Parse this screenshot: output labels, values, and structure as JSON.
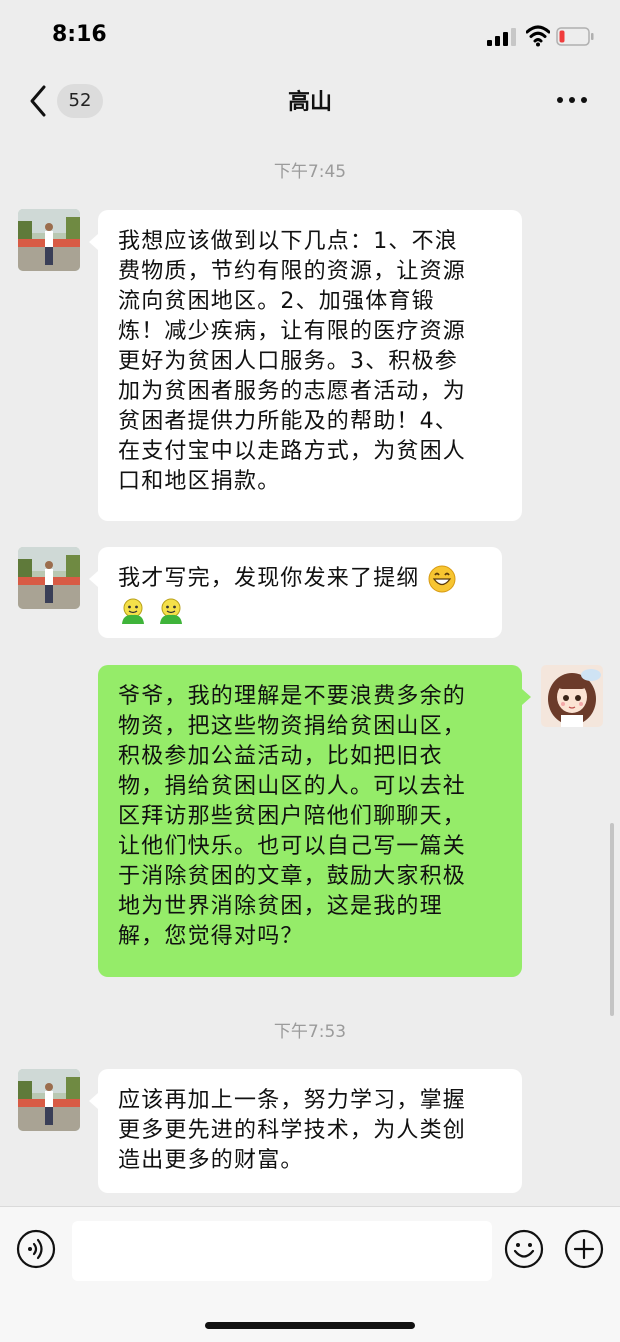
{
  "status_bar": {
    "time": "8:16"
  },
  "nav": {
    "unread_count": "52",
    "title": "高山"
  },
  "messages": [
    {
      "timestamp": "下午7:45"
    },
    {
      "sender": "other",
      "text": [
        "我想应该做到以下几点：1、不浪",
        "费物质，节约有限的资源，让资源",
        "流向贫困地区。2、加强体育锻",
        "炼！减少疾病，让有限的医疗资源",
        "更好为贫困人口服务。3、积极参",
        "加为贫困者服务的志愿者活动，为",
        "贫困者提供力所能及的帮助！4、",
        "在支付宝中以走路方式，为贫困人",
        "口和地区捐款。"
      ]
    },
    {
      "sender": "other",
      "text": [
        "我才写完，发现你发来了提纲"
      ],
      "emojis": [
        "grinning-emoji",
        "wechat-pig-emoji",
        "wechat-pig-emoji"
      ]
    },
    {
      "sender": "me",
      "text": [
        "爷爷，我的理解是不要浪费多余的",
        "物资，把这些物资捐给贫困山区，",
        "积极参加公益活动，比如把旧衣",
        "物，捐给贫困山区的人。可以去社",
        "区拜访那些贫困户陪他们聊聊天，",
        "让他们快乐。也可以自己写一篇关",
        "于消除贫困的文章，鼓励大家积极",
        "地为世界消除贫困，这是我的理",
        "解，您觉得对吗？"
      ]
    },
    {
      "timestamp": "下午7:53"
    },
    {
      "sender": "other",
      "text": [
        "应该再加上一条，努力学习，掌握",
        "更多更先进的科学技术，为人类创",
        "造出更多的财富。"
      ]
    }
  ],
  "colors": {
    "background": "#ededed",
    "my_bubble": "#95ec69",
    "their_bubble": "#ffffff",
    "timestamp": "#9b9b9b",
    "battery_low": "#f03c3c"
  },
  "icons": [
    "back-chevron-icon",
    "more-icon",
    "voice-icon",
    "emoji-icon",
    "plus-icon",
    "signal-icon",
    "wifi-icon",
    "battery-icon"
  ]
}
